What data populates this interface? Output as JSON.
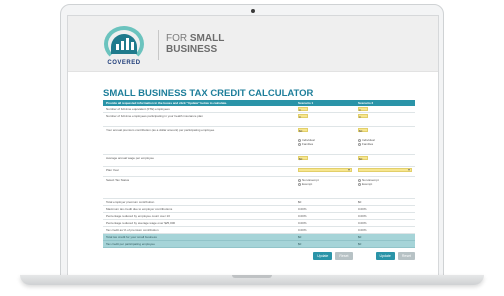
{
  "header": {
    "logo_text": "COVERED",
    "brand_line1": "FOR",
    "brand_line2": "SMALL",
    "brand_line3": "BUSINESS"
  },
  "calculator": {
    "title": "SMALL BUSINESS TAX CREDIT CALCULATOR",
    "columns": {
      "instructions": "Provide all requested information in the boxes and click \"Update\" below to calculate.",
      "scenario1": "Scenario 1",
      "scenario2": "Scenario 2"
    },
    "rows": {
      "fte": "Number of full-time equivalent (FTE) employees",
      "fte_s1": "0",
      "fte_s2": "0",
      "fte_plan": "Number of full-time employees participating in your health insurance plan",
      "fte_plan_s1": "0",
      "fte_plan_s2": "0",
      "premium": "Your annual premium contribution (as a dollar amount) per participating employee",
      "premium_s1": "$0",
      "premium_s2": "$0",
      "opt_individual": "Individual",
      "opt_families": "Families",
      "wage": "Average annual wage per employee",
      "wage_s1": "$0",
      "wage_s2": "$0",
      "plan_year": "Plan Year",
      "tax_status": "Select Tax Status",
      "opt_non_exempt": "Non-Exempt",
      "opt_exempt": "Exempt"
    },
    "results": [
      {
        "label": "Total employer premium contribution",
        "s1": "$0",
        "s2": "$0"
      },
      {
        "label": "Maximum tax credit due to employer contributions",
        "s1": "0.00%",
        "s2": "0.00%"
      },
      {
        "label": "Percentage reduced by employee count over 10",
        "s1": "0.00%",
        "s2": "0.00%"
      },
      {
        "label": "Percentage reduced by average wage over $25,000",
        "s1": "0.00%",
        "s2": "0.00%"
      },
      {
        "label": "Tax credit as % of premium contribution",
        "s1": "0.00%",
        "s2": "0.00%"
      }
    ],
    "totals": [
      {
        "label": "Total tax credit for your small business",
        "s1": "$0",
        "s2": "$0"
      },
      {
        "label": "Tax credit per participating employee",
        "s1": "$0",
        "s2": "$0"
      }
    ],
    "buttons": {
      "update": "Update",
      "reset": "Reset"
    }
  },
  "colors": {
    "teal": "#2a94a8",
    "title": "#1e7e9a",
    "input": "#f7e690",
    "total_row": "#a6d4d8"
  }
}
